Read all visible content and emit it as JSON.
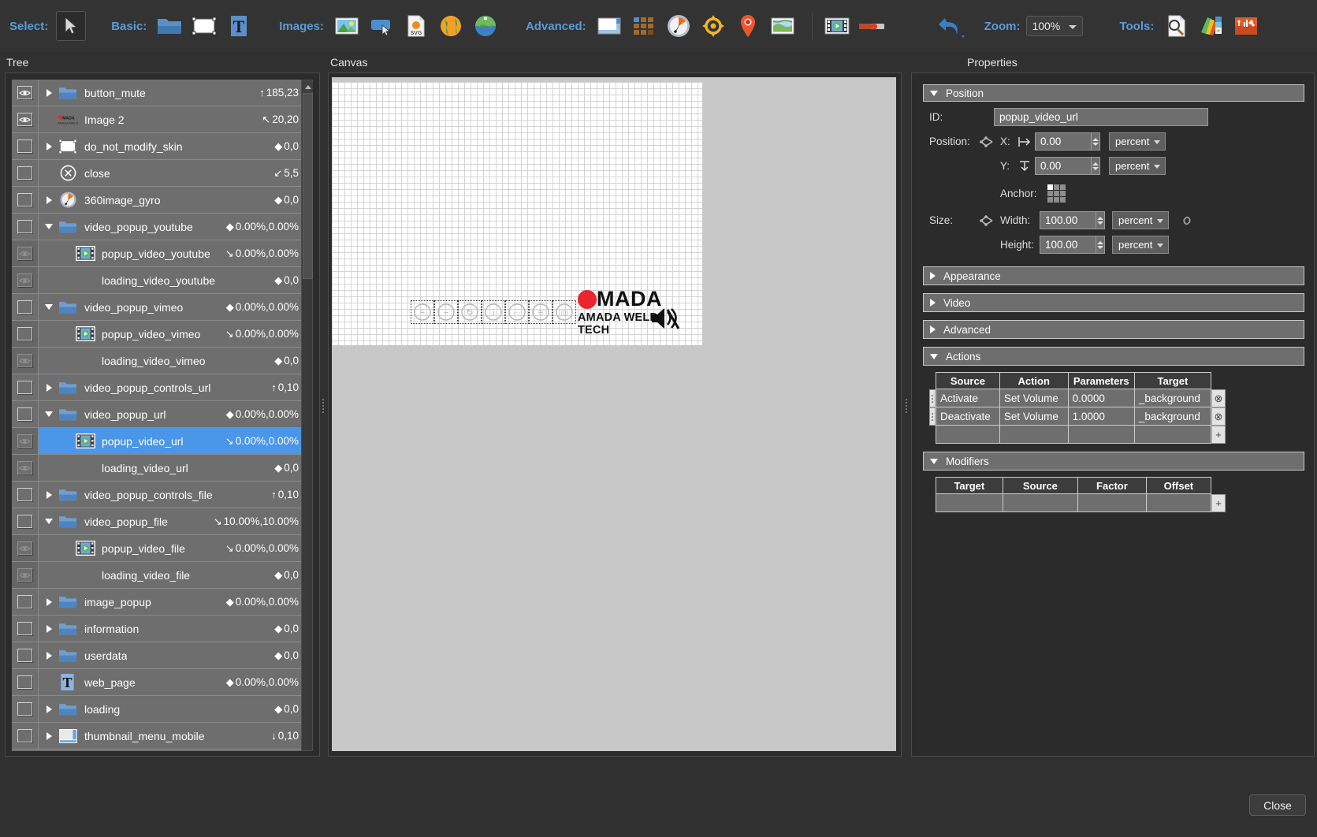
{
  "toolbar": {
    "groups": [
      {
        "label": "Select:",
        "items": [
          {
            "name": "arrow-select-icon",
            "label": "Select tool",
            "selected": true
          }
        ]
      },
      {
        "label": "Basic:",
        "items": [
          {
            "name": "folder-icon",
            "label": "Folder"
          },
          {
            "name": "rectangle-icon",
            "label": "Rectangle"
          },
          {
            "name": "text-icon",
            "label": "Text"
          }
        ]
      },
      {
        "label": "Images:",
        "items": [
          {
            "name": "image-icon",
            "label": "Image"
          },
          {
            "name": "button-icon",
            "label": "Button"
          },
          {
            "name": "svg-icon",
            "label": "SVG"
          },
          {
            "name": "world-globe-icon",
            "label": "World map"
          },
          {
            "name": "globe-green-icon",
            "label": "Globe"
          }
        ]
      },
      {
        "label": "Advanced:",
        "items": [
          {
            "name": "scroll-area-icon",
            "label": "Scroll area"
          },
          {
            "name": "thumbnail-grid-icon",
            "label": "Thumbnail grid"
          },
          {
            "name": "compass-icon",
            "label": "Compass"
          },
          {
            "name": "radar-icon",
            "label": "Radar"
          },
          {
            "name": "map-pin-icon",
            "label": "Map pin"
          },
          {
            "name": "map-icon",
            "label": "Map"
          },
          {
            "name": "video-icon",
            "label": "Video"
          },
          {
            "name": "progress-bar-icon",
            "label": "Progress bar"
          }
        ]
      }
    ],
    "undo": {
      "name": "undo-icon",
      "label": "Undo"
    },
    "zoom": {
      "label": "Zoom:",
      "value": "100%"
    },
    "tools": {
      "label": "Tools:",
      "items": [
        {
          "name": "magnifier-icon",
          "label": "Inspect"
        },
        {
          "name": "color-swatches-icon",
          "label": "Colors"
        },
        {
          "name": "toolbox-icon",
          "label": "Toolbox"
        }
      ]
    }
  },
  "panels": {
    "tree_title": "Tree",
    "canvas_title": "Canvas",
    "properties_title": "Properties"
  },
  "tree": {
    "rows": [
      {
        "visible": true,
        "expandable": true,
        "expanded": false,
        "icon": "folder-icon",
        "indent": 0,
        "label": "button_mute",
        "pos_glyph": "↑",
        "pos": "185,23"
      },
      {
        "visible": true,
        "expandable": false,
        "expanded": false,
        "icon": "amada-logo-icon",
        "indent": 0,
        "label": "Image 2",
        "pos_glyph": "↖",
        "pos": "20,20"
      },
      {
        "visible": false,
        "expandable": true,
        "expanded": false,
        "icon": "rectangle-icon",
        "indent": 0,
        "label": "do_not_modify_skin",
        "pos_glyph": "◆",
        "pos": "0,0"
      },
      {
        "visible": false,
        "expandable": false,
        "expanded": false,
        "icon": "close-circle-icon",
        "indent": 0,
        "label": "close",
        "pos_glyph": "↙",
        "pos": "5,5"
      },
      {
        "visible": false,
        "expandable": true,
        "expanded": false,
        "icon": "compass-icon",
        "indent": 0,
        "label": "360image_gyro",
        "pos_glyph": "◆",
        "pos": "0,0"
      },
      {
        "visible": false,
        "expandable": true,
        "expanded": true,
        "icon": "folder-icon",
        "indent": 0,
        "label": "video_popup_youtube",
        "pos_glyph": "◆",
        "pos": "0.00%,0.00%"
      },
      {
        "visible": "dim",
        "expandable": false,
        "expanded": false,
        "icon": "video-icon",
        "indent": 1,
        "label": "popup_video_youtube",
        "pos_glyph": "↘",
        "pos": "0.00%,0.00%"
      },
      {
        "visible": "dim",
        "expandable": false,
        "expanded": false,
        "icon": "none",
        "indent": 1,
        "label": "loading_video_youtube",
        "pos_glyph": "◆",
        "pos": "0,0"
      },
      {
        "visible": false,
        "expandable": true,
        "expanded": true,
        "icon": "folder-icon",
        "indent": 0,
        "label": "video_popup_vimeo",
        "pos_glyph": "◆",
        "pos": "0.00%,0.00%"
      },
      {
        "visible": false,
        "expandable": false,
        "expanded": false,
        "icon": "video-icon",
        "indent": 1,
        "label": "popup_video_vimeo",
        "pos_glyph": "↘",
        "pos": "0.00%,0.00%"
      },
      {
        "visible": "dim",
        "expandable": false,
        "expanded": false,
        "icon": "none",
        "indent": 1,
        "label": "loading_video_vimeo",
        "pos_glyph": "◆",
        "pos": "0,0"
      },
      {
        "visible": false,
        "expandable": true,
        "expanded": false,
        "icon": "folder-icon",
        "indent": 0,
        "label": "video_popup_controls_url",
        "pos_glyph": "↑",
        "pos": "0,10"
      },
      {
        "visible": false,
        "expandable": true,
        "expanded": true,
        "icon": "folder-icon",
        "indent": 0,
        "label": "video_popup_url",
        "pos_glyph": "◆",
        "pos": "0.00%,0.00%"
      },
      {
        "visible": "dim",
        "expandable": false,
        "expanded": false,
        "icon": "video-icon",
        "indent": 1,
        "label": "popup_video_url",
        "pos_glyph": "↘",
        "pos": "0.00%,0.00%",
        "selected": true
      },
      {
        "visible": "dim",
        "expandable": false,
        "expanded": false,
        "icon": "none",
        "indent": 1,
        "label": "loading_video_url",
        "pos_glyph": "◆",
        "pos": "0,0"
      },
      {
        "visible": false,
        "expandable": true,
        "expanded": false,
        "icon": "folder-icon",
        "indent": 0,
        "label": "video_popup_controls_file",
        "pos_glyph": "↑",
        "pos": "0,10"
      },
      {
        "visible": false,
        "expandable": true,
        "expanded": true,
        "icon": "folder-icon",
        "indent": 0,
        "label": "video_popup_file",
        "pos_glyph": "↘",
        "pos": "10.00%,10.00%"
      },
      {
        "visible": "dim",
        "expandable": false,
        "expanded": false,
        "icon": "video-icon",
        "indent": 1,
        "label": "popup_video_file",
        "pos_glyph": "↘",
        "pos": "0.00%,0.00%"
      },
      {
        "visible": "dim",
        "expandable": false,
        "expanded": false,
        "icon": "none",
        "indent": 1,
        "label": "loading_video_file",
        "pos_glyph": "◆",
        "pos": "0,0"
      },
      {
        "visible": false,
        "expandable": true,
        "expanded": false,
        "icon": "folder-icon",
        "indent": 0,
        "label": "image_popup",
        "pos_glyph": "◆",
        "pos": "0.00%,0.00%"
      },
      {
        "visible": false,
        "expandable": true,
        "expanded": false,
        "icon": "folder-icon",
        "indent": 0,
        "label": "information",
        "pos_glyph": "◆",
        "pos": "0,0"
      },
      {
        "visible": false,
        "expandable": true,
        "expanded": false,
        "icon": "folder-icon",
        "indent": 0,
        "label": "userdata",
        "pos_glyph": "◆",
        "pos": "0,0"
      },
      {
        "visible": false,
        "expandable": false,
        "expanded": false,
        "icon": "text-icon",
        "indent": 0,
        "label": "web_page",
        "pos_glyph": "◆",
        "pos": "0.00%,0.00%"
      },
      {
        "visible": false,
        "expandable": true,
        "expanded": false,
        "icon": "folder-icon",
        "indent": 0,
        "label": "loading",
        "pos_glyph": "◆",
        "pos": "0,0"
      },
      {
        "visible": false,
        "expandable": true,
        "expanded": false,
        "icon": "thumbnail-menu-icon",
        "indent": 0,
        "label": "thumbnail_menu_mobile",
        "pos_glyph": "↓",
        "pos": "0,10"
      }
    ]
  },
  "canvas": {
    "skin_buttons": [
      {
        "name": "zoom-in-button",
        "glyph": "+"
      },
      {
        "name": "zoom-out-button",
        "glyph": "−"
      },
      {
        "name": "rotate-button",
        "glyph": "↻"
      },
      {
        "name": "info-button",
        "glyph": "i"
      },
      {
        "name": "more-button",
        "glyph": "···"
      },
      {
        "name": "list-button",
        "glyph": "≡"
      },
      {
        "name": "gyro-button",
        "glyph": "◎"
      }
    ],
    "logo": {
      "brand": "MADA",
      "tagline": "AMADA WELD TECH"
    },
    "mute_icon": "mute-speaker-icon"
  },
  "properties": {
    "position_section": {
      "title": "Position",
      "expanded": true,
      "id_label": "ID:",
      "id_value": "popup_video_url",
      "position_label": "Position:",
      "x_label": "X:",
      "x_value": "0.00",
      "x_unit": "percent",
      "y_label": "Y:",
      "y_value": "0.00",
      "y_unit": "percent",
      "anchor_label": "Anchor:",
      "anchor_selected": "top-left",
      "size_label": "Size:",
      "width_label": "Width:",
      "width_value": "100.00",
      "width_unit": "percent",
      "height_label": "Height:",
      "height_value": "100.00",
      "height_unit": "percent",
      "link_icon": "chain-link-icon"
    },
    "collapsed_sections": [
      {
        "title": "Appearance"
      },
      {
        "title": "Video"
      },
      {
        "title": "Advanced"
      }
    ],
    "actions_section": {
      "title": "Actions",
      "expanded": true,
      "columns": [
        "Source",
        "Action",
        "Parameters",
        "Target"
      ],
      "rows": [
        {
          "source": "Activate",
          "action": "Set Volume",
          "parameters": "0.0000",
          "target": "_background"
        },
        {
          "source": "Deactivate",
          "action": "Set Volume",
          "parameters": "1.0000",
          "target": "_background"
        },
        {
          "source": "",
          "action": "",
          "parameters": "",
          "target": ""
        }
      ],
      "add_button": "+",
      "remove_button": "⊗"
    },
    "modifiers_section": {
      "title": "Modifiers",
      "expanded": true,
      "columns": [
        "Target",
        "Source",
        "Factor",
        "Offset"
      ],
      "rows": [
        {
          "target": "",
          "source": "",
          "factor": "",
          "offset": ""
        }
      ],
      "add_button": "+"
    }
  },
  "footer": {
    "close_label": "Close"
  },
  "colors": {
    "accent_blue": "#5b9bd5",
    "selection_blue": "#4a96e8",
    "panel_bg": "#2b2b2b",
    "row_bg": "#6e6e6e",
    "app_bg": "#303030",
    "logo_red": "#e8262b"
  }
}
